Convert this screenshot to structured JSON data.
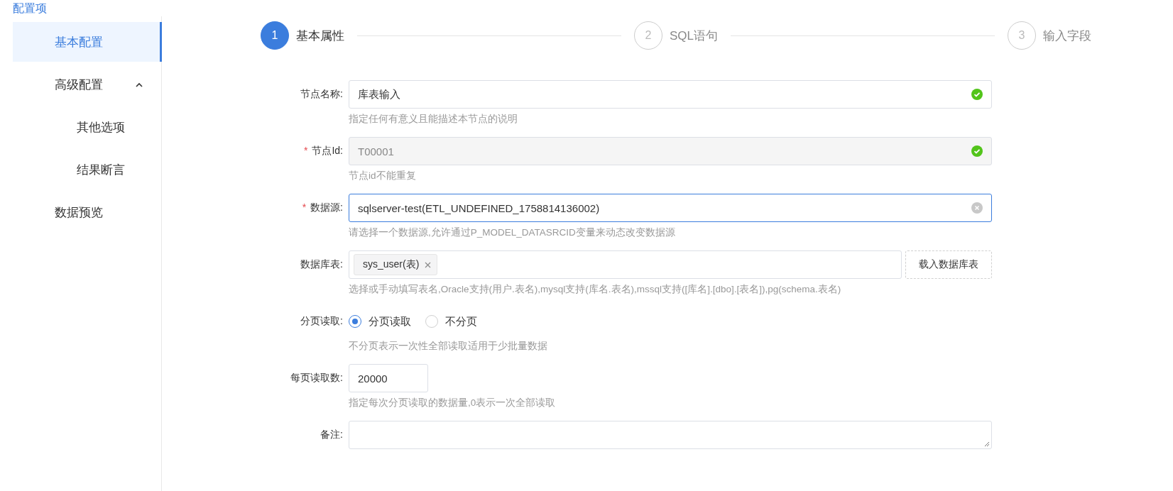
{
  "sidebar": {
    "title": "配置项",
    "items": [
      {
        "label": "基本配置",
        "selected": true
      },
      {
        "label": "高级配置",
        "selected": false,
        "expanded": true,
        "children": [
          {
            "label": "其他选项",
            "selected": false
          },
          {
            "label": "结果断言",
            "selected": false
          }
        ]
      },
      {
        "label": "数据预览",
        "selected": false
      }
    ]
  },
  "steps": [
    {
      "number": "1",
      "label": "基本属性",
      "selected": true
    },
    {
      "number": "2",
      "label": "SQL语句",
      "selected": false
    },
    {
      "number": "3",
      "label": "输入字段",
      "selected": false
    }
  ],
  "fields": [
    {
      "kind": "text",
      "label": "节点名称:",
      "value": "库表输入",
      "valid": true,
      "disabled": false,
      "hint": "指定任何有意义且能描述本节点的说明"
    },
    {
      "kind": "text",
      "label": "节点Id:",
      "required_mark": "*",
      "value": "T00001",
      "valid": true,
      "disabled": true,
      "hint": "节点id不能重复"
    },
    {
      "kind": "text",
      "label": "数据源:",
      "required_mark": "*",
      "value": "sqlserver-test(ETL_UNDEFINED_1758814136002)",
      "clearable": true,
      "focused": true,
      "disabled": false,
      "hint": "请选择一个数据源,允许通过P_MODEL_DATASRCID变量来动态改变数据源"
    },
    {
      "kind": "tags",
      "label": "数据库表:",
      "tags": [
        "sys_user(表)"
      ],
      "button": "载入数据库表",
      "hint": "选择或手动填写表名,Oracle支持(用户.表名),mysql支持(库名.表名),mssql支持([库名].[dbo].[表名]),pg(schema.表名)"
    },
    {
      "kind": "radio",
      "label": "分页读取:",
      "options": [
        {
          "label": "分页读取",
          "selected": true
        },
        {
          "label": "不分页",
          "selected": false
        }
      ],
      "hint": "不分页表示一次性全部读取适用于少批量数据"
    },
    {
      "kind": "number",
      "label": "每页读取数:",
      "value": "20000",
      "hint": "指定每次分页读取的数据量,0表示一次全部读取"
    },
    {
      "kind": "textarea",
      "label": "备注:"
    }
  ]
}
